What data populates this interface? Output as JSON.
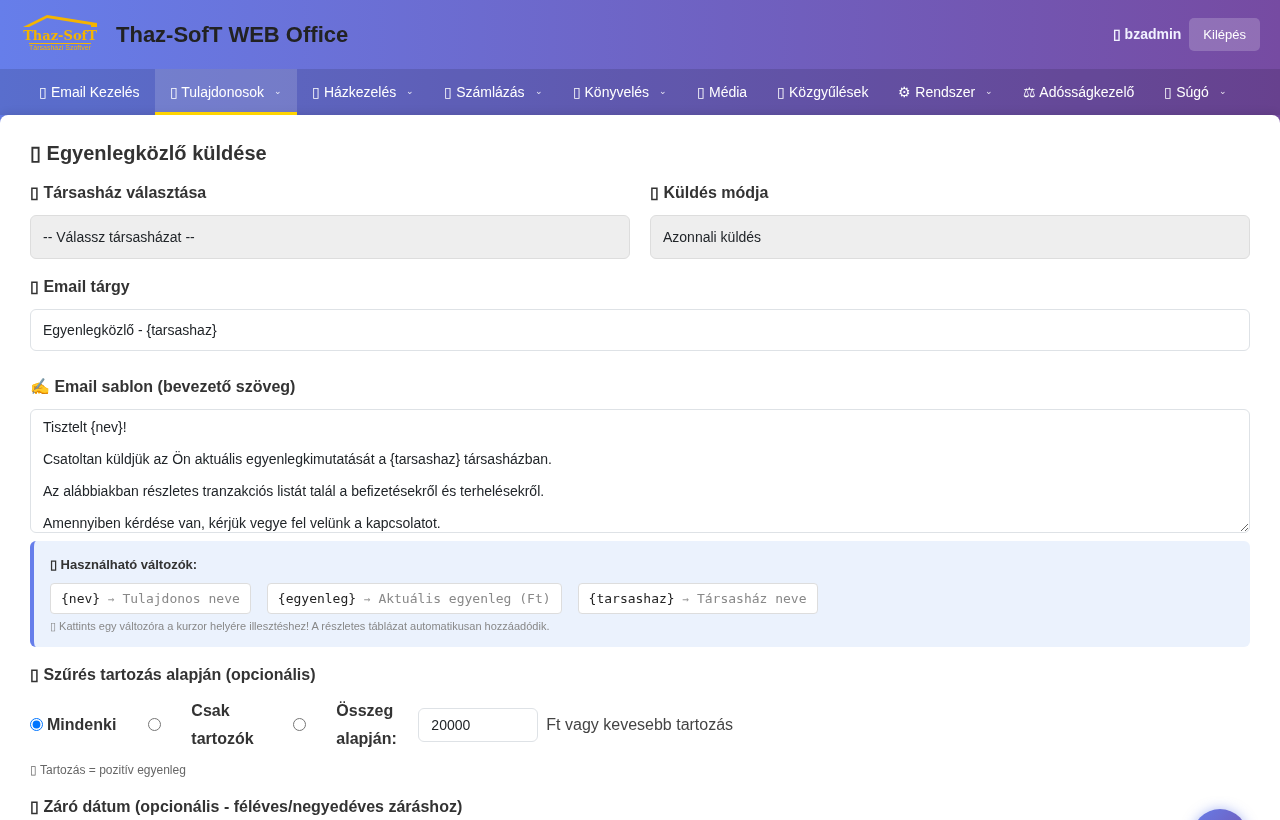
{
  "header": {
    "logo_text": "Thaz-SofT",
    "logo_subtitle": "Társasházi Szoftver",
    "title": "Thaz-SofT WEB Office",
    "user": "▯ bzadmin",
    "logout": "Kilépés"
  },
  "nav": [
    {
      "label": "▯ Email Kezelés",
      "selected": false
    },
    {
      "label": "▯ Tulajdonosok",
      "selected": true,
      "caret": "⌄"
    },
    {
      "label": "▯ Házkezelés",
      "selected": false,
      "caret": "⌄"
    },
    {
      "label": "▯ Számlázás",
      "selected": false,
      "caret": "⌄"
    },
    {
      "label": "▯ Könyvelés",
      "selected": false,
      "caret": "⌄"
    },
    {
      "label": "▯ Média",
      "selected": false
    },
    {
      "label": "▯ Közgyűlések",
      "selected": false
    },
    {
      "label": "⚙ Rendszer",
      "selected": false,
      "caret": "⌄"
    },
    {
      "label": "⚖ Adósságkezelő",
      "selected": false
    },
    {
      "label": "▯ Súgó",
      "selected": false,
      "caret": "⌄"
    }
  ],
  "page_title": "▯ Egyenlegközlő küldése",
  "house": {
    "label": "▯ Társasház választása",
    "value": "-- Válassz társasházat --"
  },
  "send_mode": {
    "label": "▯ Küldés módja",
    "value": "Azonnali küldés"
  },
  "subject": {
    "label": "▯ Email tárgy",
    "value": "Egyenlegközlő - {tarsashaz}"
  },
  "template": {
    "label": "✍ Email sablon (bevezető szöveg)",
    "value": "Tisztelt {nev}!\n\nCsatoltan küldjük az Ön aktuális egyenlegkimutatását a {tarsashaz} társasházban.\n\nAz alábbiakban részletes tranzakciós listát talál a befizetésekről és terhelésekről.\n\nAmennyiben kérdése van, kérjük vegye fel velünk a kapcsolatot."
  },
  "variables": {
    "title": "▯ Használható változók:",
    "items": [
      {
        "name": "{nev}",
        "arrow": "→",
        "desc": "Tulajdonos neve"
      },
      {
        "name": "{egyenleg}",
        "arrow": "→",
        "desc": "Aktuális egyenleg (Ft)"
      },
      {
        "name": "{tarsashaz}",
        "arrow": "→",
        "desc": "Társasház neve"
      }
    ],
    "hint": "▯ Kattints egy változóra a kurzor helyére illesztéshez! A részletes táblázat automatikusan hozzáadódik."
  },
  "filter": {
    "label": "▯ Szűrés tartozás alapján (opcionális)",
    "options": [
      {
        "label": "Mindenki",
        "selected": true
      },
      {
        "label": "Csak tartozók",
        "selected": false
      },
      {
        "label": "Összeg alapján:",
        "selected": false
      }
    ],
    "amount": "20000",
    "suffix": "Ft vagy kevesebb tartozás",
    "note": "▯ Tartozás = pozitív egyenleg"
  },
  "closing_date": {
    "label": "▯ Záró dátum (opcionális - féléves/negyedéves záráshoz)"
  }
}
